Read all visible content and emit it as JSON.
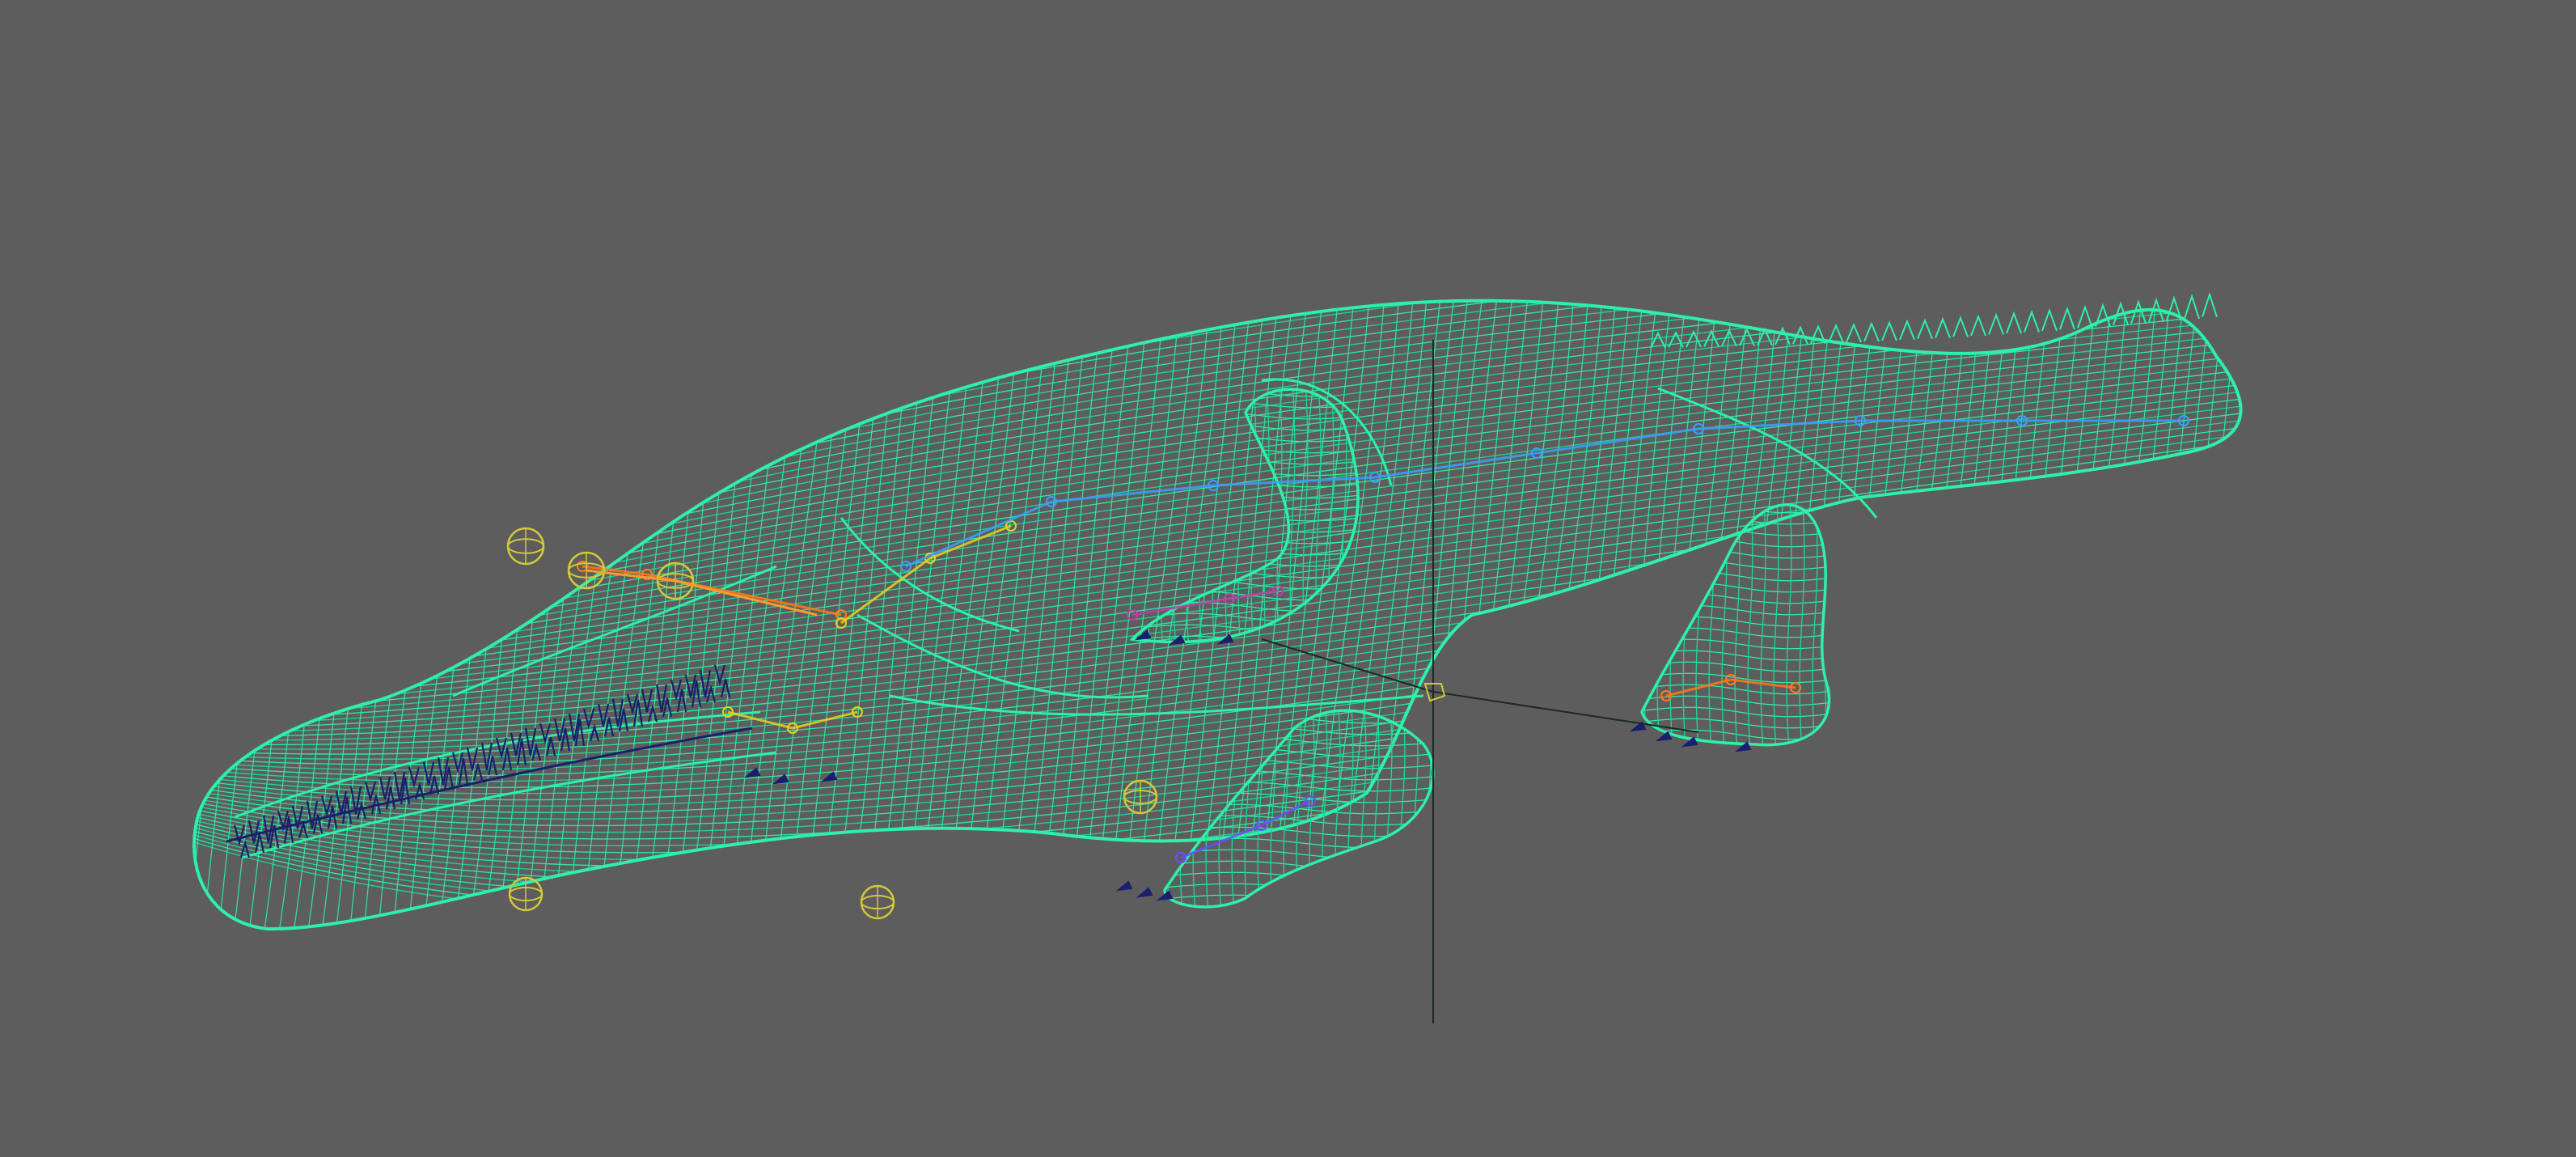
{
  "viewport": {
    "background_color": "#5d5d5d",
    "display_mode": "wireframe"
  },
  "scene": {
    "model": {
      "subject": "crocodile",
      "wire_color": "#2ef0a8",
      "wire_color_alt": "#1fd79a"
    },
    "teeth": {
      "color": "#1a1f6e"
    },
    "rig": {
      "joint_colors": [
        "#ff7a1a",
        "#e6d21e",
        "#c23aa8",
        "#3aa0ff",
        "#6a4cff"
      ],
      "control_color": "#d2c83a"
    },
    "manipulator": {
      "axis_color": "#1a2a22"
    }
  }
}
